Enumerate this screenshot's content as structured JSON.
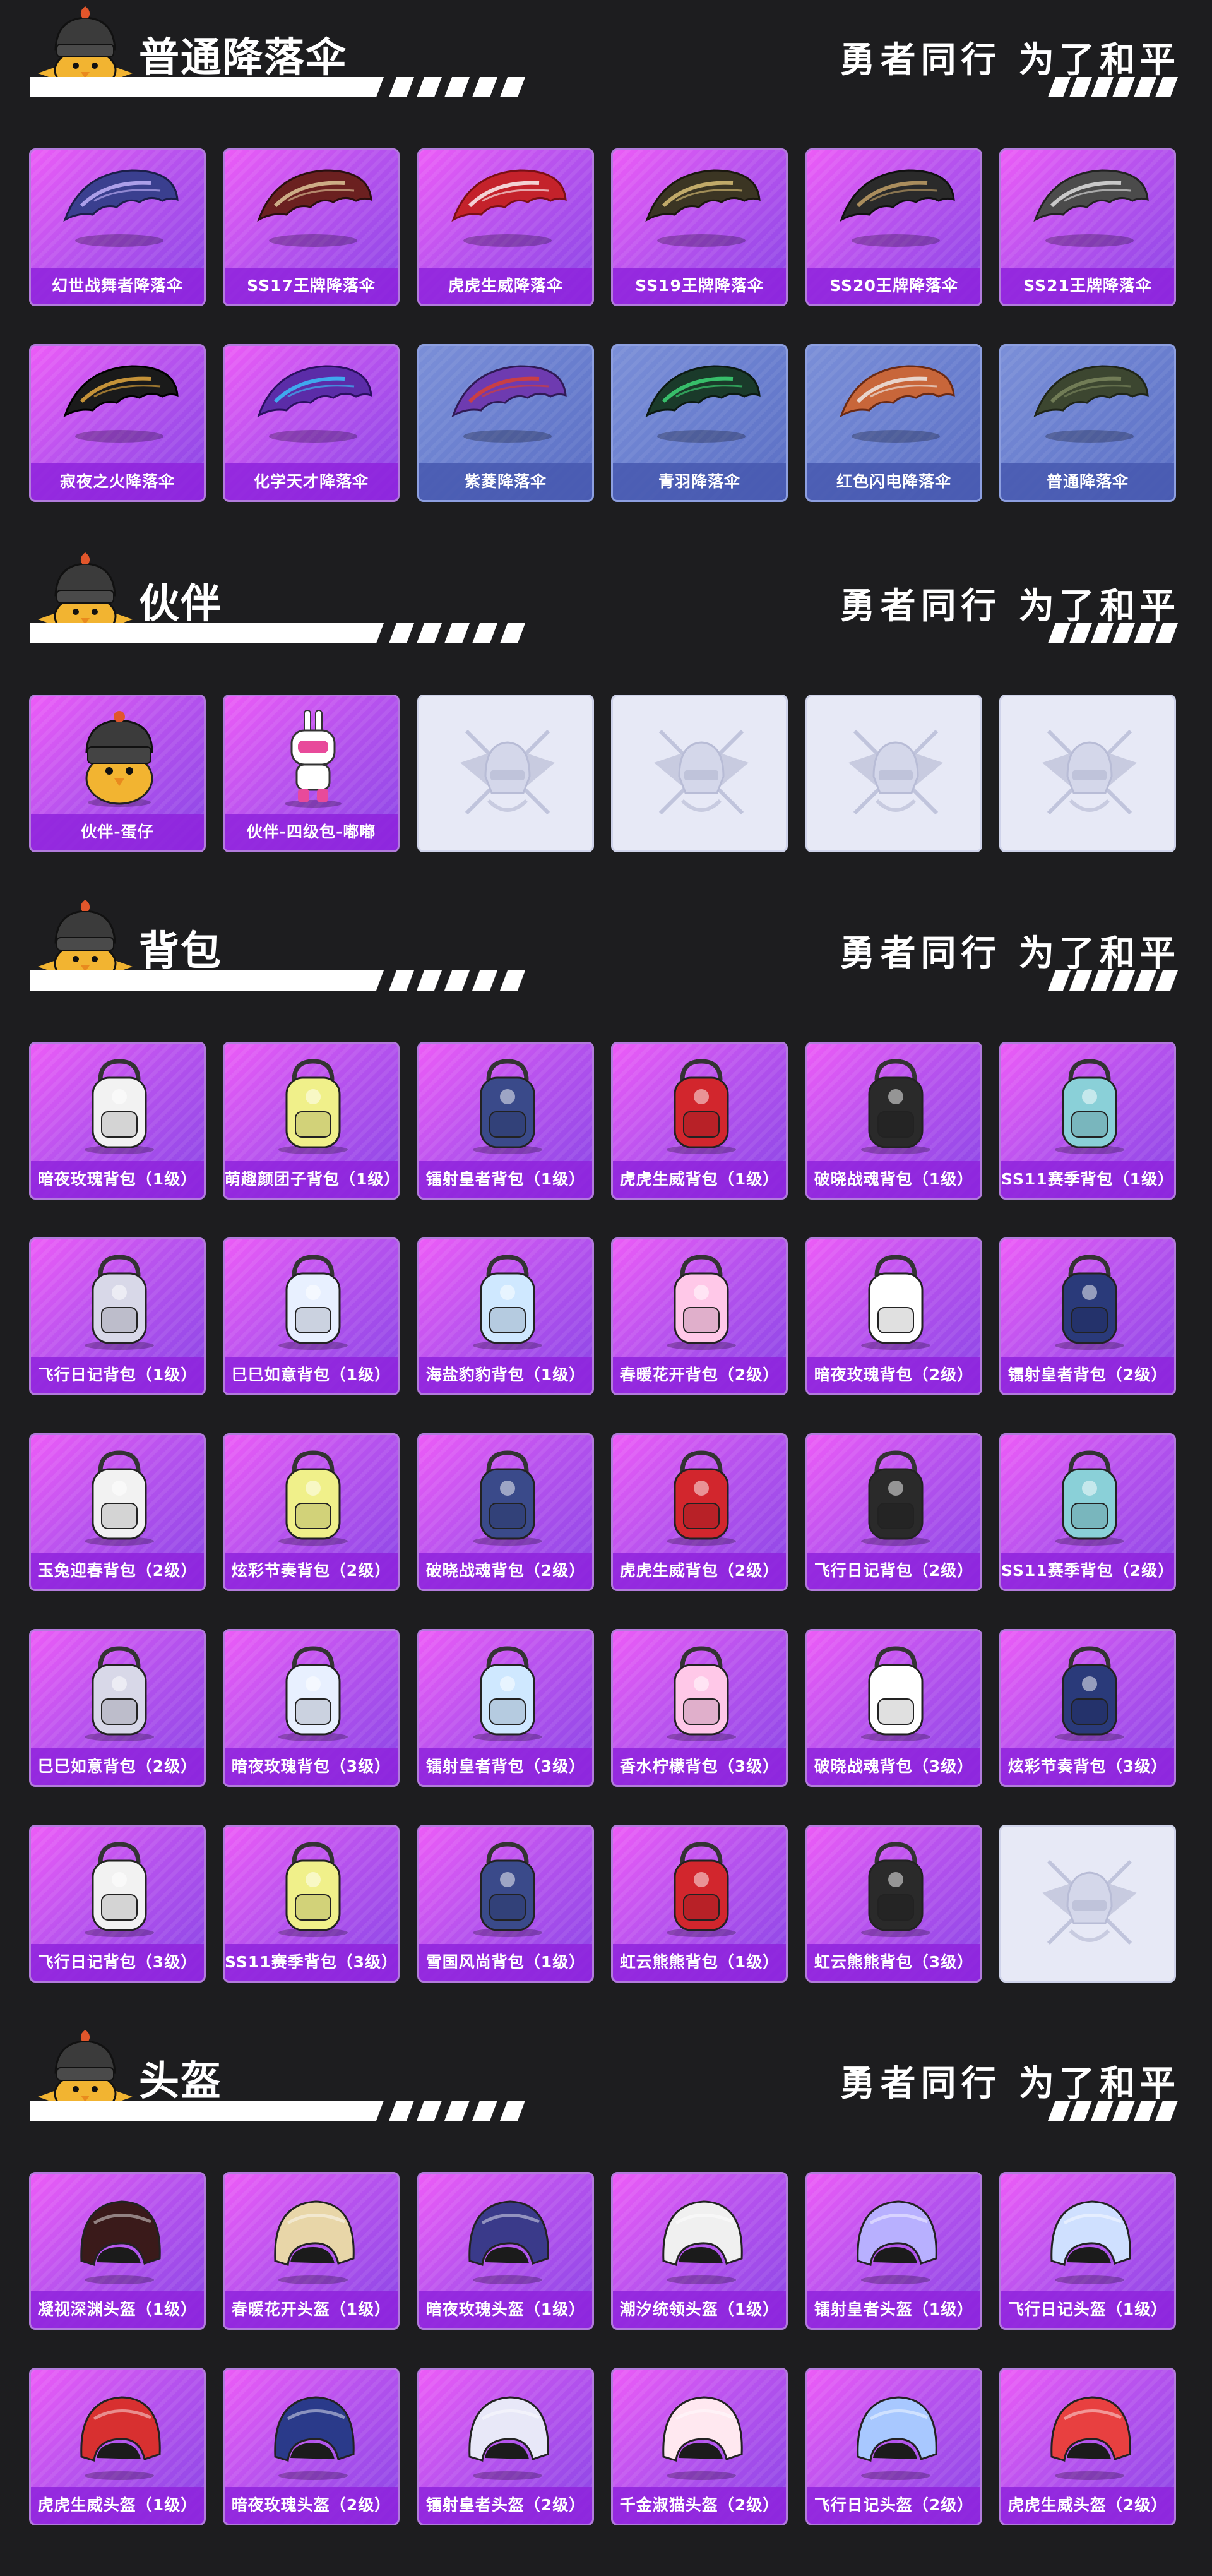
{
  "slogan": "勇者同行 为了和平",
  "colors": {
    "page_bg": "#1d1d1f",
    "card_purple": "#b853ee",
    "card_blue": "#6a7fcf",
    "card_empty": "#e7e9f6",
    "label_bg": "#8e22dc"
  },
  "sections": [
    {
      "title": "普通降落伞",
      "items": [
        {
          "label": "幻世战舞者降落伞",
          "style": "purple",
          "icon": "parachute-icon"
        },
        {
          "label": "SS17王牌降落伞",
          "style": "purple",
          "icon": "parachute-icon"
        },
        {
          "label": "虎虎生威降落伞",
          "style": "purple",
          "icon": "parachute-icon"
        },
        {
          "label": "SS19王牌降落伞",
          "style": "purple",
          "icon": "parachute-icon"
        },
        {
          "label": "SS20王牌降落伞",
          "style": "purple",
          "icon": "parachute-icon"
        },
        {
          "label": "SS21王牌降落伞",
          "style": "purple",
          "icon": "parachute-icon"
        },
        {
          "label": "寂夜之火降落伞",
          "style": "purple",
          "icon": "parachute-icon"
        },
        {
          "label": "化学天才降落伞",
          "style": "purple",
          "icon": "parachute-icon"
        },
        {
          "label": "紫菱降落伞",
          "style": "blue",
          "icon": "parachute-icon"
        },
        {
          "label": "青羽降落伞",
          "style": "blue",
          "icon": "parachute-icon"
        },
        {
          "label": "红色闪电降落伞",
          "style": "blue",
          "icon": "parachute-icon"
        },
        {
          "label": "普通降落伞",
          "style": "blue",
          "icon": "parachute-icon"
        }
      ]
    },
    {
      "title": "伙伴",
      "items": [
        {
          "label": "伙伴-蛋仔",
          "style": "purple",
          "icon": "chick-companion-icon"
        },
        {
          "label": "伙伴-四级包-嘟嘟",
          "style": "purple",
          "icon": "robot-bunny-icon"
        },
        {
          "label": "",
          "style": "empty",
          "icon": "placeholder-emblem-icon"
        },
        {
          "label": "",
          "style": "empty",
          "icon": "placeholder-emblem-icon"
        },
        {
          "label": "",
          "style": "empty",
          "icon": "placeholder-emblem-icon"
        },
        {
          "label": "",
          "style": "empty",
          "icon": "placeholder-emblem-icon"
        }
      ]
    },
    {
      "title": "背包",
      "items": [
        {
          "label": "暗夜玫瑰背包（1级）",
          "style": "purple",
          "icon": "backpack-icon"
        },
        {
          "label": "萌趣颜团子背包（1级）",
          "style": "purple",
          "icon": "backpack-icon"
        },
        {
          "label": "镭射皇者背包（1级）",
          "style": "purple",
          "icon": "backpack-icon"
        },
        {
          "label": "虎虎生威背包（1级）",
          "style": "purple",
          "icon": "backpack-icon"
        },
        {
          "label": "破晓战魂背包（1级）",
          "style": "purple",
          "icon": "backpack-icon"
        },
        {
          "label": "SS11赛季背包（1级）",
          "style": "purple",
          "icon": "backpack-icon"
        },
        {
          "label": "飞行日记背包（1级）",
          "style": "purple",
          "icon": "backpack-icon"
        },
        {
          "label": "巳巳如意背包（1级）",
          "style": "purple",
          "icon": "backpack-icon"
        },
        {
          "label": "海盐豹豹背包（1级）",
          "style": "purple",
          "icon": "backpack-icon"
        },
        {
          "label": "春暖花开背包（2级）",
          "style": "purple",
          "icon": "backpack-icon"
        },
        {
          "label": "暗夜玫瑰背包（2级）",
          "style": "purple",
          "icon": "backpack-icon"
        },
        {
          "label": "镭射皇者背包（2级）",
          "style": "purple",
          "icon": "backpack-icon"
        },
        {
          "label": "玉兔迎春背包（2级）",
          "style": "purple",
          "icon": "backpack-icon"
        },
        {
          "label": "炫彩节奏背包（2级）",
          "style": "purple",
          "icon": "backpack-icon"
        },
        {
          "label": "破晓战魂背包（2级）",
          "style": "purple",
          "icon": "backpack-icon"
        },
        {
          "label": "虎虎生威背包（2级）",
          "style": "purple",
          "icon": "backpack-icon"
        },
        {
          "label": "飞行日记背包（2级）",
          "style": "purple",
          "icon": "backpack-icon"
        },
        {
          "label": "SS11赛季背包（2级）",
          "style": "purple",
          "icon": "backpack-icon"
        },
        {
          "label": "巳巳如意背包（2级）",
          "style": "purple",
          "icon": "backpack-icon"
        },
        {
          "label": "暗夜玫瑰背包（3级）",
          "style": "purple",
          "icon": "backpack-icon"
        },
        {
          "label": "镭射皇者背包（3级）",
          "style": "purple",
          "icon": "backpack-icon"
        },
        {
          "label": "香水柠檬背包（3级）",
          "style": "purple",
          "icon": "backpack-icon"
        },
        {
          "label": "破晓战魂背包（3级）",
          "style": "purple",
          "icon": "backpack-icon"
        },
        {
          "label": "炫彩节奏背包（3级）",
          "style": "purple",
          "icon": "backpack-icon"
        },
        {
          "label": "飞行日记背包（3级）",
          "style": "purple",
          "icon": "backpack-icon"
        },
        {
          "label": "SS11赛季背包（3级）",
          "style": "purple",
          "icon": "backpack-icon"
        },
        {
          "label": "雪国风尚背包（1级）",
          "style": "purple",
          "icon": "backpack-icon"
        },
        {
          "label": "虹云熊熊背包（1级）",
          "style": "purple",
          "icon": "backpack-icon"
        },
        {
          "label": "虹云熊熊背包（3级）",
          "style": "purple",
          "icon": "backpack-icon"
        },
        {
          "label": "",
          "style": "empty",
          "icon": "placeholder-emblem-icon"
        }
      ]
    },
    {
      "title": "头盔",
      "items": [
        {
          "label": "凝视深渊头盔（1级）",
          "style": "purple",
          "icon": "helmet-icon"
        },
        {
          "label": "春暖花开头盔（1级）",
          "style": "purple",
          "icon": "helmet-icon"
        },
        {
          "label": "暗夜玫瑰头盔（1级）",
          "style": "purple",
          "icon": "helmet-icon"
        },
        {
          "label": "潮汐统领头盔（1级）",
          "style": "purple",
          "icon": "helmet-icon"
        },
        {
          "label": "镭射皇者头盔（1级）",
          "style": "purple",
          "icon": "helmet-icon"
        },
        {
          "label": "飞行日记头盔（1级）",
          "style": "purple",
          "icon": "helmet-icon"
        },
        {
          "label": "虎虎生威头盔（1级）",
          "style": "purple",
          "icon": "helmet-icon"
        },
        {
          "label": "暗夜玫瑰头盔（2级）",
          "style": "purple",
          "icon": "helmet-icon"
        },
        {
          "label": "镭射皇者头盔（2级）",
          "style": "purple",
          "icon": "helmet-icon"
        },
        {
          "label": "千金淑猫头盔（2级）",
          "style": "purple",
          "icon": "helmet-icon"
        },
        {
          "label": "飞行日记头盔（2级）",
          "style": "purple",
          "icon": "helmet-icon"
        },
        {
          "label": "虎虎生威头盔（2级）",
          "style": "purple",
          "icon": "helmet-icon"
        }
      ]
    }
  ]
}
